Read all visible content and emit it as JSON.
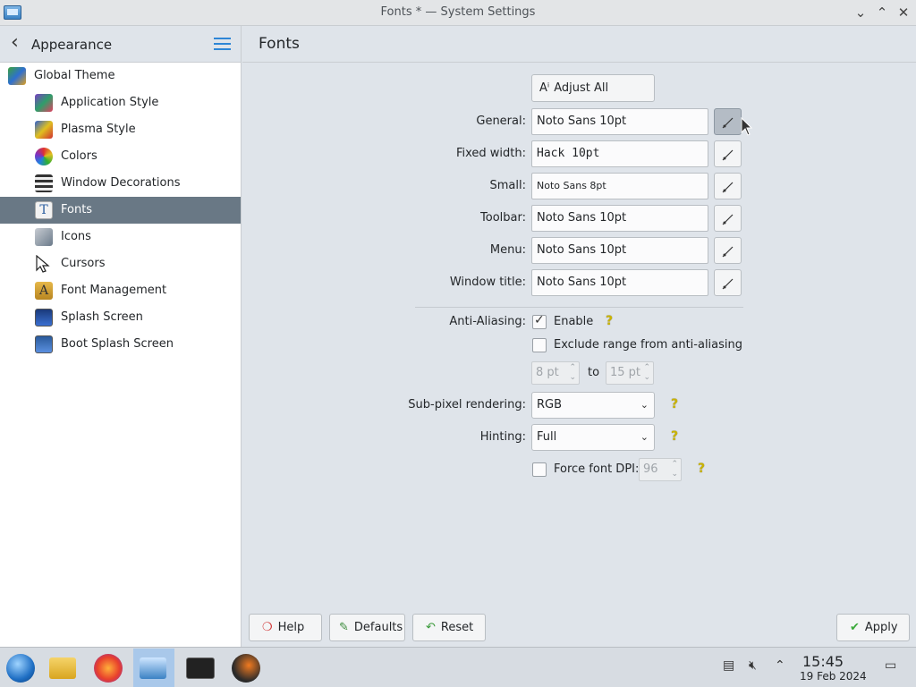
{
  "window": {
    "title": "Fonts * — System Settings"
  },
  "sidebar": {
    "header_title": "Appearance",
    "items": [
      {
        "label": "Global Theme",
        "icon": "global-theme-icon",
        "level": "top"
      },
      {
        "label": "Application Style",
        "icon": "application-style-icon",
        "level": "sub"
      },
      {
        "label": "Plasma Style",
        "icon": "plasma-style-icon",
        "level": "sub"
      },
      {
        "label": "Colors",
        "icon": "colors-icon",
        "level": "sub"
      },
      {
        "label": "Window Decorations",
        "icon": "window-decorations-icon",
        "level": "sub"
      },
      {
        "label": "Fonts",
        "icon": "fonts-icon",
        "level": "sub",
        "selected": true
      },
      {
        "label": "Icons",
        "icon": "icons-icon",
        "level": "sub"
      },
      {
        "label": "Cursors",
        "icon": "cursor-icon",
        "level": "sub"
      },
      {
        "label": "Font Management",
        "icon": "font-management-icon",
        "level": "sub"
      },
      {
        "label": "Splash Screen",
        "icon": "splash-screen-icon",
        "level": "sub"
      },
      {
        "label": "Boot Splash Screen",
        "icon": "boot-splash-screen-icon",
        "level": "sub"
      }
    ]
  },
  "main": {
    "page_title": "Fonts",
    "adjust_all_label": "Adjust All Fonts...",
    "font_rows": [
      {
        "label": "General:",
        "value": "Noto Sans 10pt"
      },
      {
        "label": "Fixed width:",
        "value": "Hack 10pt"
      },
      {
        "label": "Small:",
        "value": "Noto Sans 8pt"
      },
      {
        "label": "Toolbar:",
        "value": "Noto Sans 10pt"
      },
      {
        "label": "Menu:",
        "value": "Noto Sans 10pt"
      },
      {
        "label": "Window title:",
        "value": "Noto Sans 10pt"
      }
    ],
    "anti_aliasing": {
      "label": "Anti-Aliasing:",
      "enable_label": "Enable",
      "enable_checked": true,
      "exclude_label": "Exclude range from anti-aliasing",
      "exclude_checked": false,
      "range_from": "8 pt",
      "range_to_label": "to",
      "range_to": "15 pt"
    },
    "subpixel": {
      "label": "Sub-pixel rendering:",
      "value": "RGB"
    },
    "hinting": {
      "label": "Hinting:",
      "value": "Full"
    },
    "force_dpi": {
      "label": "Force font DPI:",
      "checked": false,
      "value": "96"
    },
    "buttons": {
      "help": "Help",
      "defaults": "Defaults",
      "reset": "Reset",
      "apply": "Apply"
    }
  },
  "taskbar": {
    "time": "15:45",
    "date": "19 Feb 2024"
  }
}
